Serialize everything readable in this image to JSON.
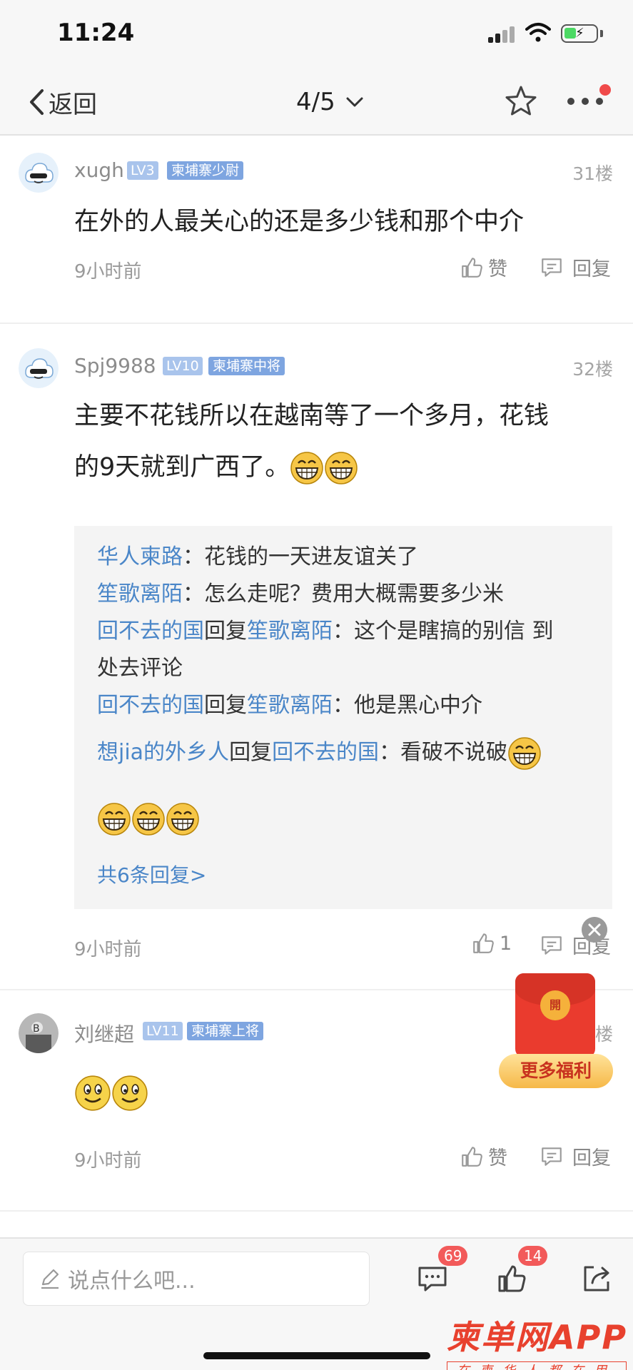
{
  "status_bar": {
    "time": "11:24"
  },
  "nav": {
    "back_label": "返回",
    "page_indicator": "4/5"
  },
  "posts": [
    {
      "username": "xugh",
      "level": "LV3",
      "title": "柬埔寨少尉",
      "floor": "31楼",
      "content": "在外的人最关心的还是多少钱和那个中介",
      "time": "9小时前",
      "like_label": "赞",
      "reply_label": "回复"
    },
    {
      "username": "Spj9988",
      "level": "LV10",
      "title": "柬埔寨中将",
      "floor": "32楼",
      "content_line1": "主要不花钱所以在越南等了一个多月，花钱",
      "content_line2": "的9天就到广西了。",
      "time": "9小时前",
      "like_count": "1",
      "reply_label": "回复",
      "replies": {
        "r1": {
          "name": "华人柬路",
          "text": "：花钱的一天进友谊关了"
        },
        "r2": {
          "name": "笙歌离陌",
          "text": "：怎么走呢？费用大概需要多少米"
        },
        "r3": {
          "name": "回不去的国",
          "mid": "回复",
          "target": "笙歌离陌",
          "text": "：这个是瞎搞的别信 到",
          "text2": "处去评论"
        },
        "r4": {
          "name": "回不去的国",
          "mid": "回复",
          "target": "笙歌离陌",
          "text": "：他是黑心中介"
        },
        "r5": {
          "name": "想jia的外乡人",
          "mid": "回复",
          "target": "回不去的国",
          "text": "：看破不说破"
        },
        "more": "共6条回复>"
      }
    },
    {
      "username": "刘继超",
      "level": "LV11",
      "title": "柬埔寨上将",
      "floor": "楼",
      "time": "9小时前",
      "like_label": "赞",
      "reply_label": "回复"
    }
  ],
  "floating": {
    "more_welfare": "更多福利",
    "coin_label": "開"
  },
  "bottom_bar": {
    "input_placeholder": "说点什么吧...",
    "comment_count": "69",
    "like_count": "14"
  },
  "watermark": {
    "main": "柬单网APP",
    "sub": "在柬华人都在用"
  },
  "colors": {
    "link_blue": "#4a86c8",
    "badge_red": "#f25a5a",
    "level_badge": "#a9c4ec",
    "title_badge": "#7ea5e0"
  },
  "icons": [
    "chevron-left-icon",
    "chevron-down-icon",
    "star-icon",
    "more-icon",
    "thumbs-up-icon",
    "comment-icon",
    "grin-emoji-icon",
    "smile-emoji-icon",
    "pencil-icon",
    "share-icon",
    "close-icon",
    "red-packet-icon"
  ]
}
